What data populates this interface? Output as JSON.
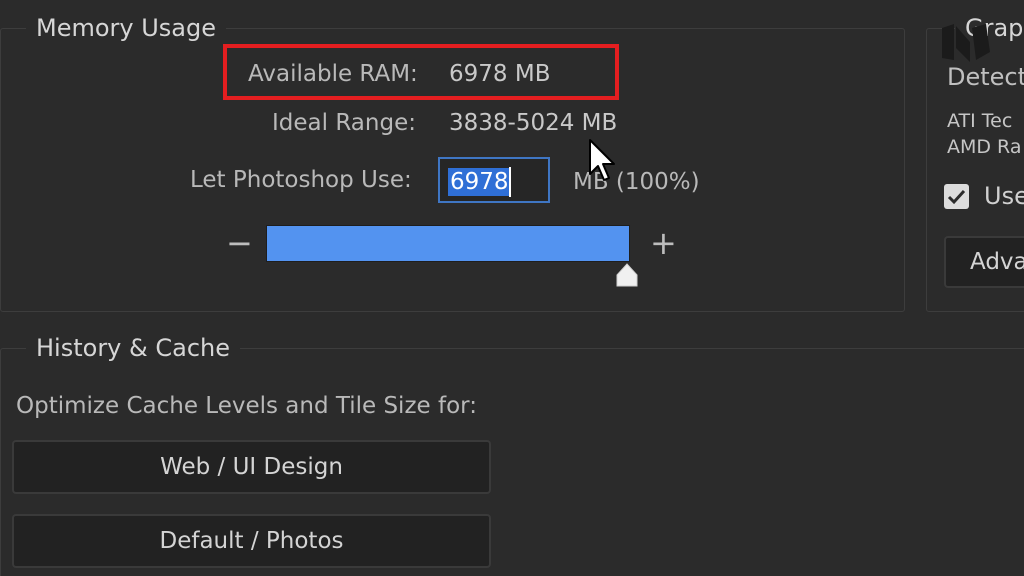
{
  "memory": {
    "title": "Memory Usage",
    "available_label": "Available RAM:",
    "available_value": "6978 MB",
    "ideal_label": "Ideal Range:",
    "ideal_value": "3838-5024 MB",
    "let_label": "Let Photoshop Use:",
    "input_value": "6978",
    "unit_suffix": "MB (100%)",
    "slider": {
      "minus": "−",
      "plus": "+",
      "percent": 100
    },
    "highlight_color": "#e41e20"
  },
  "graphics": {
    "title": "Graph",
    "detected_label": "Detect",
    "gpu_line1": "ATI Tec",
    "gpu_line2": "AMD Ra",
    "use_label": "Use",
    "use_checked": true,
    "advanced_button": "Adva"
  },
  "history": {
    "title": "History & Cache",
    "optimize_label": "Optimize Cache Levels and Tile Size for:",
    "buttons": [
      {
        "label": "Web / UI Design"
      },
      {
        "label": "Default / Photos"
      }
    ]
  },
  "icons": {
    "cursor": "mouse-pointer-icon",
    "logo": "watermark-logo-icon",
    "thumb": "slider-thumb-icon",
    "check": "checkmark-icon"
  },
  "colors": {
    "background": "#2b2b2b",
    "accent": "#5393f0",
    "selection": "#2f6fd6",
    "input_border": "#3f76c4"
  }
}
